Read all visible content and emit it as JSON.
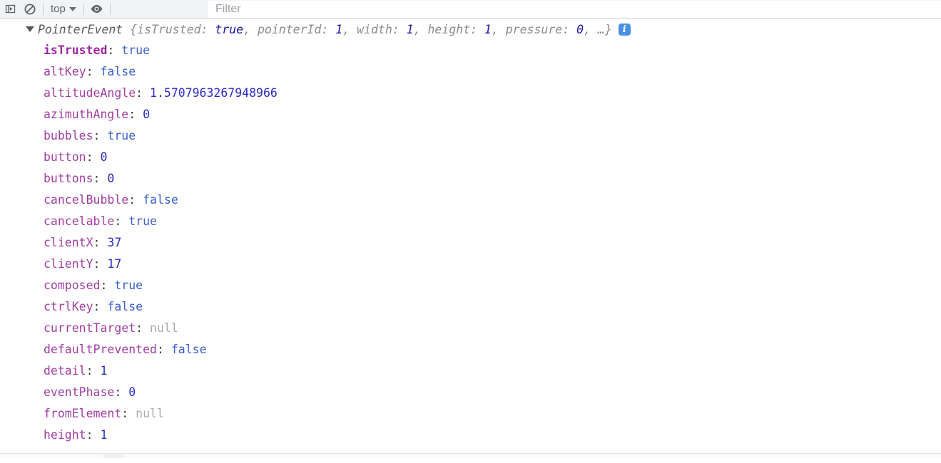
{
  "toolbar": {
    "execute_label": "execute-snippet-icon",
    "clear_label": "clear-console-icon",
    "context_label": "top",
    "eye_label": "live-expression-icon",
    "filter_placeholder": "Filter",
    "filter_value": ""
  },
  "console": {
    "object_header": {
      "constructor": "PointerEvent",
      "open_brace": " {",
      "preview": [
        {
          "key": "isTrusted",
          "sep": ": ",
          "value": "true",
          "type": "bool",
          "trail": ", "
        },
        {
          "key": "pointerId",
          "sep": ": ",
          "value": "1",
          "type": "num",
          "trail": ", "
        },
        {
          "key": "width",
          "sep": ": ",
          "value": "1",
          "type": "num",
          "trail": ", "
        },
        {
          "key": "height",
          "sep": ": ",
          "value": "1",
          "type": "num",
          "trail": ", "
        },
        {
          "key": "pressure",
          "sep": ": ",
          "value": "0",
          "type": "num",
          "trail": ", "
        }
      ],
      "ellipsis": "…",
      "close_brace": "}",
      "info_badge": "i"
    },
    "properties": [
      {
        "name": "isTrusted",
        "value": "true",
        "type": "bool",
        "bold": true
      },
      {
        "name": "altKey",
        "value": "false",
        "type": "bool",
        "bold": false
      },
      {
        "name": "altitudeAngle",
        "value": "1.5707963267948966",
        "type": "num",
        "bold": false
      },
      {
        "name": "azimuthAngle",
        "value": "0",
        "type": "num",
        "bold": false
      },
      {
        "name": "bubbles",
        "value": "true",
        "type": "bool",
        "bold": false
      },
      {
        "name": "button",
        "value": "0",
        "type": "num",
        "bold": false
      },
      {
        "name": "buttons",
        "value": "0",
        "type": "num",
        "bold": false
      },
      {
        "name": "cancelBubble",
        "value": "false",
        "type": "bool",
        "bold": false
      },
      {
        "name": "cancelable",
        "value": "true",
        "type": "bool",
        "bold": false
      },
      {
        "name": "clientX",
        "value": "37",
        "type": "num",
        "bold": false
      },
      {
        "name": "clientY",
        "value": "17",
        "type": "num",
        "bold": false
      },
      {
        "name": "composed",
        "value": "true",
        "type": "bool",
        "bold": false
      },
      {
        "name": "ctrlKey",
        "value": "false",
        "type": "bool",
        "bold": false
      },
      {
        "name": "currentTarget",
        "value": "null",
        "type": "null",
        "bold": false
      },
      {
        "name": "defaultPrevented",
        "value": "false",
        "type": "bool",
        "bold": false
      },
      {
        "name": "detail",
        "value": "1",
        "type": "num",
        "bold": false
      },
      {
        "name": "eventPhase",
        "value": "0",
        "type": "num",
        "bold": false
      },
      {
        "name": "fromElement",
        "value": "null",
        "type": "null",
        "bold": false
      },
      {
        "name": "height",
        "value": "1",
        "type": "num",
        "bold": false
      }
    ]
  }
}
